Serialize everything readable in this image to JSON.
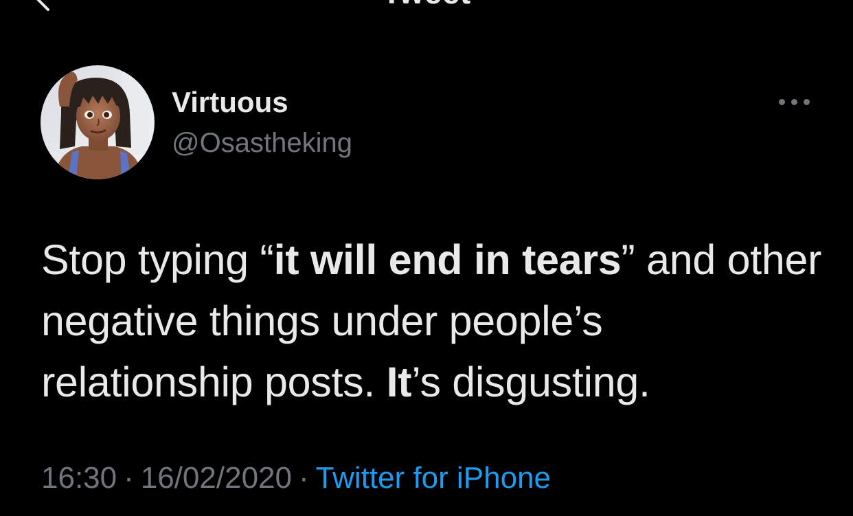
{
  "header": {
    "title": "Tweet",
    "back_icon": "chevron-left-icon"
  },
  "tweet": {
    "author": {
      "display_name": "Virtuous",
      "handle": "@Osastheking",
      "avatar": "profile-avatar"
    },
    "more_icon": "more-horizontal-icon",
    "text": {
      "part1": "Stop typing “",
      "bold1": "it will end in tears",
      "part2": "” and other negative things under people’s relationship posts. ",
      "bold2": "It",
      "part3": "’s disgusting."
    },
    "time": "16:30",
    "date": "16/02/2020",
    "separator": "·",
    "source": "Twitter for iPhone"
  },
  "colors": {
    "background": "#000000",
    "primary_text": "#e7e9ea",
    "secondary_text": "#71767b",
    "link": "#1d9bf0"
  }
}
